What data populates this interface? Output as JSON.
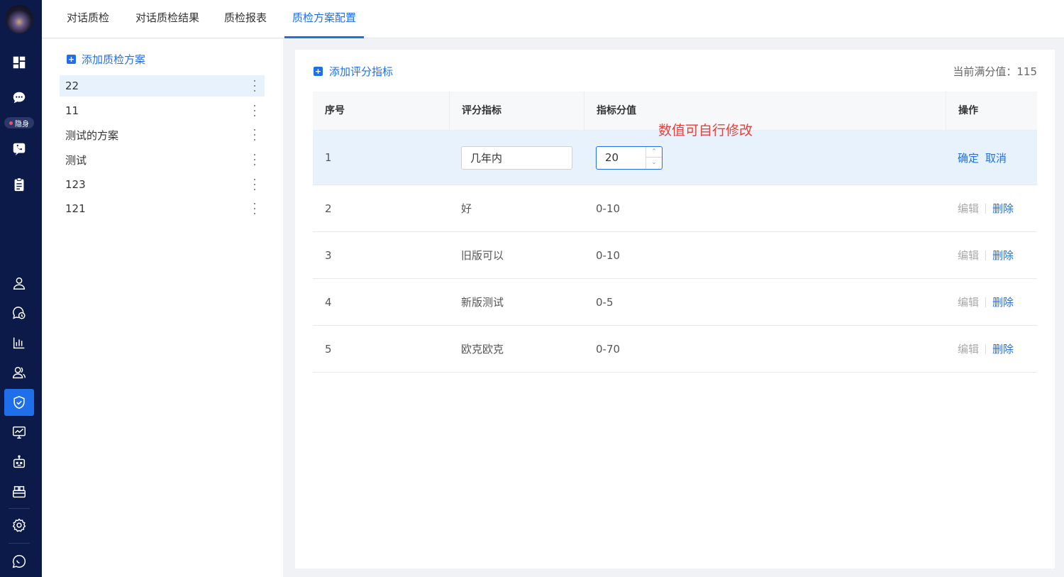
{
  "top_tabs": [
    {
      "label": "对话质检",
      "active": false
    },
    {
      "label": "对话质检结果",
      "active": false
    },
    {
      "label": "质检报表",
      "active": false
    },
    {
      "label": "质检方案配置",
      "active": true
    }
  ],
  "sidebar": {
    "status_label": "隐身",
    "icons": [
      "dashboard-icon",
      "chat-icon",
      "phone-chat-icon",
      "clipboard-icon",
      "user-icon",
      "history-chat-icon",
      "bar-chart-icon",
      "team-icon",
      "shield-icon",
      "monitor-chart-icon",
      "robot-icon",
      "toolbox-icon",
      "settings-icon",
      "message-icon"
    ],
    "active_icon": "shield-icon"
  },
  "plan_panel": {
    "add_label": "添加质检方案",
    "plans": [
      {
        "name": "22",
        "selected": true
      },
      {
        "name": "11",
        "selected": false
      },
      {
        "name": "测试的方案",
        "selected": false
      },
      {
        "name": "测试",
        "selected": false
      },
      {
        "name": "123",
        "selected": false
      },
      {
        "name": "121",
        "selected": false
      }
    ]
  },
  "main": {
    "add_index_label": "添加评分指标",
    "full_score": "当前满分值：115",
    "columns": [
      "序号",
      "评分指标",
      "指标分值",
      "操作"
    ],
    "editing_row": {
      "index": "1",
      "name_value": "几年内",
      "score_value": "20",
      "confirm_label": "确定",
      "cancel_label": "取消"
    },
    "rows": [
      {
        "index": "2",
        "name": "好",
        "range": "0-10"
      },
      {
        "index": "3",
        "name": "旧版可以",
        "range": "0-10"
      },
      {
        "index": "4",
        "name": "新版测试",
        "range": "0-5"
      },
      {
        "index": "5",
        "name": "欧克欧克",
        "range": "0-70"
      }
    ],
    "edit_label": "编辑",
    "delete_label": "删除"
  },
  "annotation": "数值可自行修改",
  "colors": {
    "accent": "#1f6feb",
    "rail": "#0c1a4a",
    "annotation": "#e8403a",
    "selected_bg": "#e8f2fd"
  }
}
